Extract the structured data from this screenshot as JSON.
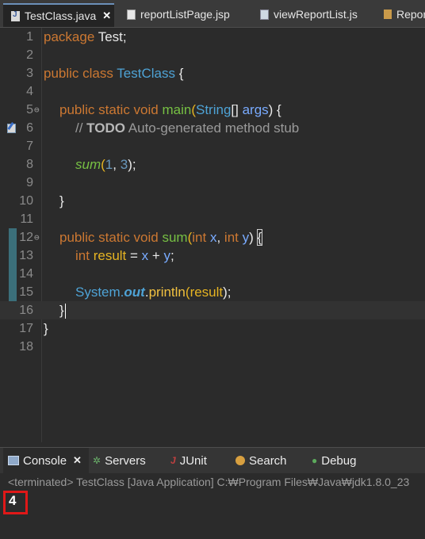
{
  "editor_tabs": [
    {
      "label": "TestClass.java",
      "icon": "java-file-icon",
      "active": true,
      "close": "✕"
    },
    {
      "label": "reportListPage.jsp",
      "icon": "jsp-file-icon",
      "active": false
    },
    {
      "label": "viewReportList.js",
      "icon": "js-file-icon",
      "active": false
    },
    {
      "label": "Repor",
      "icon": "report-file-icon",
      "active": false
    }
  ],
  "line_numbers": [
    "1",
    "2",
    "3",
    "4",
    "5",
    "6",
    "7",
    "8",
    "9",
    "10",
    "11",
    "12",
    "13",
    "14",
    "15",
    "16",
    "17",
    "18"
  ],
  "fold_marker": "⊖",
  "code": {
    "l1_kw": "package",
    "l1_rest": " Test;",
    "l3_kw": "public class",
    "l3_cls": "TestClass",
    "l3_rest": " {",
    "l5_kw": "public static void",
    "l5_meth": "main",
    "l5_open": "(",
    "l5_type": "String",
    "l5_arr": "[] ",
    "l5_param": "args",
    "l5_close": ") {",
    "l6_cmt": "// ",
    "l6_todo": "TODO",
    "l6_rest": " Auto-generated method stub",
    "l8_call": "sum",
    "l8_open": "(",
    "l8_a": "1",
    "l8_sep": ", ",
    "l8_b": "3",
    "l8_close": ");",
    "l10": "}",
    "l12_kw": "public static void",
    "l12_meth": "sum",
    "l12_open": "(",
    "l12_int1": "int",
    "l12_x": "x",
    "l12_comma": ", ",
    "l12_int2": "int",
    "l12_y": "y",
    "l12_close": ") ",
    "l12_brace": "{",
    "l13_int": "int",
    "l13_result": "result",
    "l13_eq": " = ",
    "l13_x": "x",
    "l13_plus": " + ",
    "l13_y": "y",
    "l13_semi": ";",
    "l15_sys": "System.",
    "l15_out": "out",
    "l15_dot": ".",
    "l15_println": "println",
    "l15_open": "(",
    "l15_result": "result",
    "l15_close": ");",
    "l16": "}",
    "l17": "}"
  },
  "console_tabs": [
    {
      "label": "Console",
      "icon": "console-icon",
      "active": true,
      "close": "✕"
    },
    {
      "label": "Servers",
      "icon": "servers-icon"
    },
    {
      "label": "JUnit",
      "icon": "junit-icon"
    },
    {
      "label": "Search",
      "icon": "search-icon"
    },
    {
      "label": "Debug",
      "icon": "debug-icon"
    }
  ],
  "console_status": "<terminated> TestClass [Java Application] C:₩Program Files₩Java₩jdk1.8.0_23",
  "console_output": "4",
  "colors": {
    "keyword": "#cc7832",
    "class": "#4ea3d6",
    "method_decl": "#76c043",
    "highlight_box": "#e01818"
  }
}
